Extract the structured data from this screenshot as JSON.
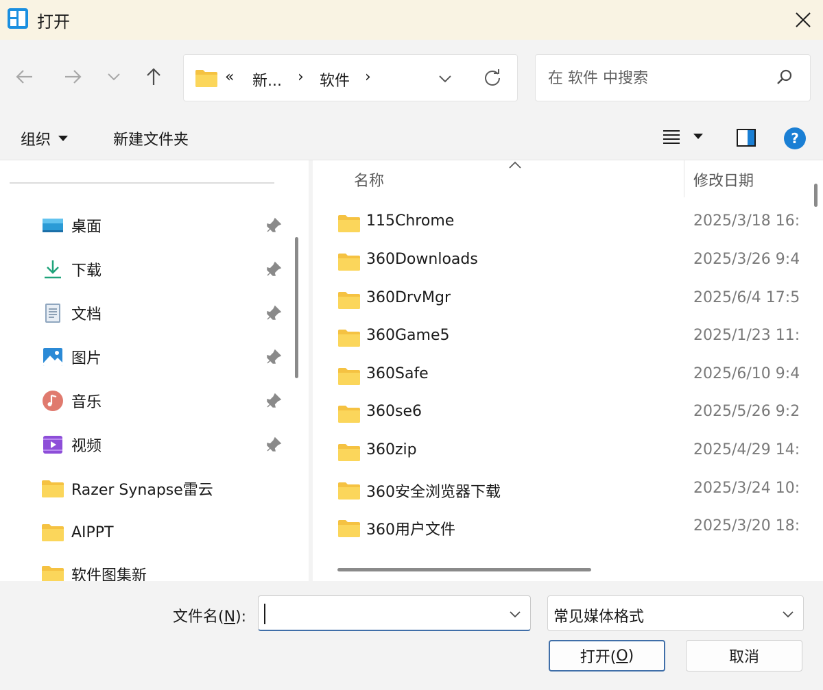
{
  "window": {
    "title": "打开",
    "close_icon": "close-icon"
  },
  "nav": {
    "back_icon": "arrow-left-icon",
    "forward_icon": "arrow-right-icon",
    "recent_icon": "chevron-down-icon",
    "up_icon": "arrow-up-icon"
  },
  "address": {
    "overflow": "«",
    "crumb_1": "新...",
    "sep_1": "›",
    "crumb_2": "软件",
    "sep_2": "›"
  },
  "search": {
    "placeholder": "在 软件 中搜索"
  },
  "toolbar": {
    "organize_label": "组织",
    "new_folder_label": "新建文件夹"
  },
  "sidebar": {
    "items": [
      {
        "label": "桌面",
        "icon": "desktop-icon",
        "pinned": true
      },
      {
        "label": "下载",
        "icon": "download-icon",
        "pinned": true
      },
      {
        "label": "文档",
        "icon": "document-icon",
        "pinned": true
      },
      {
        "label": "图片",
        "icon": "pictures-icon",
        "pinned": true
      },
      {
        "label": "音乐",
        "icon": "music-icon",
        "pinned": true
      },
      {
        "label": "视频",
        "icon": "video-icon",
        "pinned": true
      },
      {
        "label": "Razer Synapse雷云",
        "icon": "folder-icon",
        "pinned": false
      },
      {
        "label": "AIPPT",
        "icon": "folder-icon",
        "pinned": false
      },
      {
        "label": "软件图集新",
        "icon": "folder-icon",
        "pinned": false
      }
    ]
  },
  "filelist": {
    "columns": {
      "name": "名称",
      "modified": "修改日期"
    },
    "rows": [
      {
        "name": "115Chrome",
        "date": "2025/3/18 16:"
      },
      {
        "name": "360Downloads",
        "date": "2025/3/26 9:4"
      },
      {
        "name": "360DrvMgr",
        "date": "2025/6/4 17:5"
      },
      {
        "name": "360Game5",
        "date": "2025/1/23 11:"
      },
      {
        "name": "360Safe",
        "date": "2025/6/10 9:4"
      },
      {
        "name": "360se6",
        "date": "2025/5/26 9:2"
      },
      {
        "name": "360zip",
        "date": "2025/4/29 14:"
      },
      {
        "name": "360安全浏览器下载",
        "date": "2025/3/24 10:"
      },
      {
        "name": "360用户文件",
        "date": "2025/3/20 18:"
      }
    ]
  },
  "footer": {
    "filename_label": "文件名(",
    "filename_key": "N",
    "filename_label_end": "):",
    "filename_value": "",
    "filetype_value": "常见媒体格式",
    "open_label": "打开(",
    "open_key": "O",
    "open_label_end": ")",
    "cancel_label": "取消"
  },
  "colors": {
    "accent": "#3f6ea8",
    "folder": "#f5c242",
    "help": "#1a7fd4"
  }
}
